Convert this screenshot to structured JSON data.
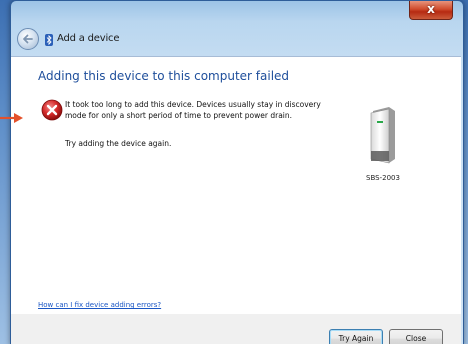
{
  "window": {
    "title": "Add a device",
    "close_label": "x"
  },
  "content": {
    "heading": "Adding this device to this computer failed",
    "message": "It took too long to add this device. Devices usually stay in discovery mode for only a short period of time to prevent power drain.",
    "retry_text": "Try adding the device again.",
    "device_label": "SBS-2003",
    "help_link": "How can I fix device adding errors?"
  },
  "buttons": {
    "try_again": "Try Again",
    "close": "Close"
  },
  "colors": {
    "heading": "#1e4e9b",
    "link": "#1a56c4",
    "error_red": "#c8202a",
    "annotation_arrow": "#e4512b"
  },
  "icons": {
    "back": "back-arrow-icon",
    "bluetooth": "bluetooth-icon",
    "error": "error-icon",
    "device": "computer-tower-icon",
    "annotation": "red-arrow-icon"
  }
}
